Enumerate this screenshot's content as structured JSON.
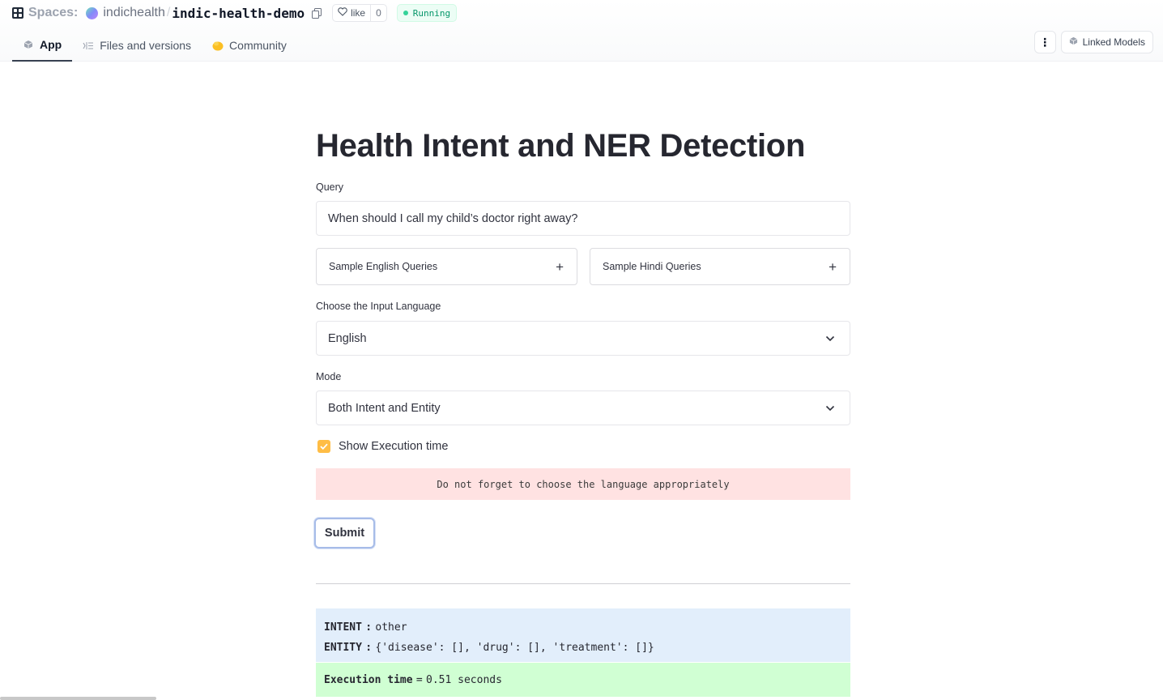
{
  "header": {
    "spaces_label": "Spaces:",
    "owner": "indichealth",
    "separator": "/",
    "repo": "indic-health-demo",
    "like_label": "like",
    "like_count": "0",
    "status": "Running",
    "status_color": "#059669",
    "tabs": [
      {
        "label": "App",
        "icon": "app-cube-icon",
        "active": true
      },
      {
        "label": "Files and versions",
        "icon": "files-icon",
        "active": false
      },
      {
        "label": "Community",
        "icon": "community-icon",
        "active": false
      }
    ],
    "more_label": "⋮",
    "linked_models_label": "Linked Models"
  },
  "app": {
    "title": "Health Intent and NER Detection",
    "query_label": "Query",
    "query_value": "When should I call my child’s doctor right away?",
    "expanders": [
      {
        "label": "Sample English Queries",
        "icon": "+"
      },
      {
        "label": "Sample Hindi Queries",
        "icon": "+"
      }
    ],
    "language_label": "Choose the Input Language",
    "language_value": "English",
    "mode_label": "Mode",
    "mode_value": "Both Intent and Entity",
    "checkbox_label": "Show Execution time",
    "checkbox_checked": true,
    "accent_color": "#ffbd45",
    "alert_text": "Do not forget to choose the language appropriately",
    "submit_label": "Submit",
    "result": {
      "intent_key": "INTENT",
      "intent_sep": ":",
      "intent_value": "other",
      "entity_key": "ENTITY",
      "entity_sep": ":",
      "entity_value": "{'disease': [], 'drug': [], 'treatment': []}"
    },
    "execution": {
      "key": "Execution time",
      "sep": "=",
      "value": "0.51 seconds"
    }
  }
}
